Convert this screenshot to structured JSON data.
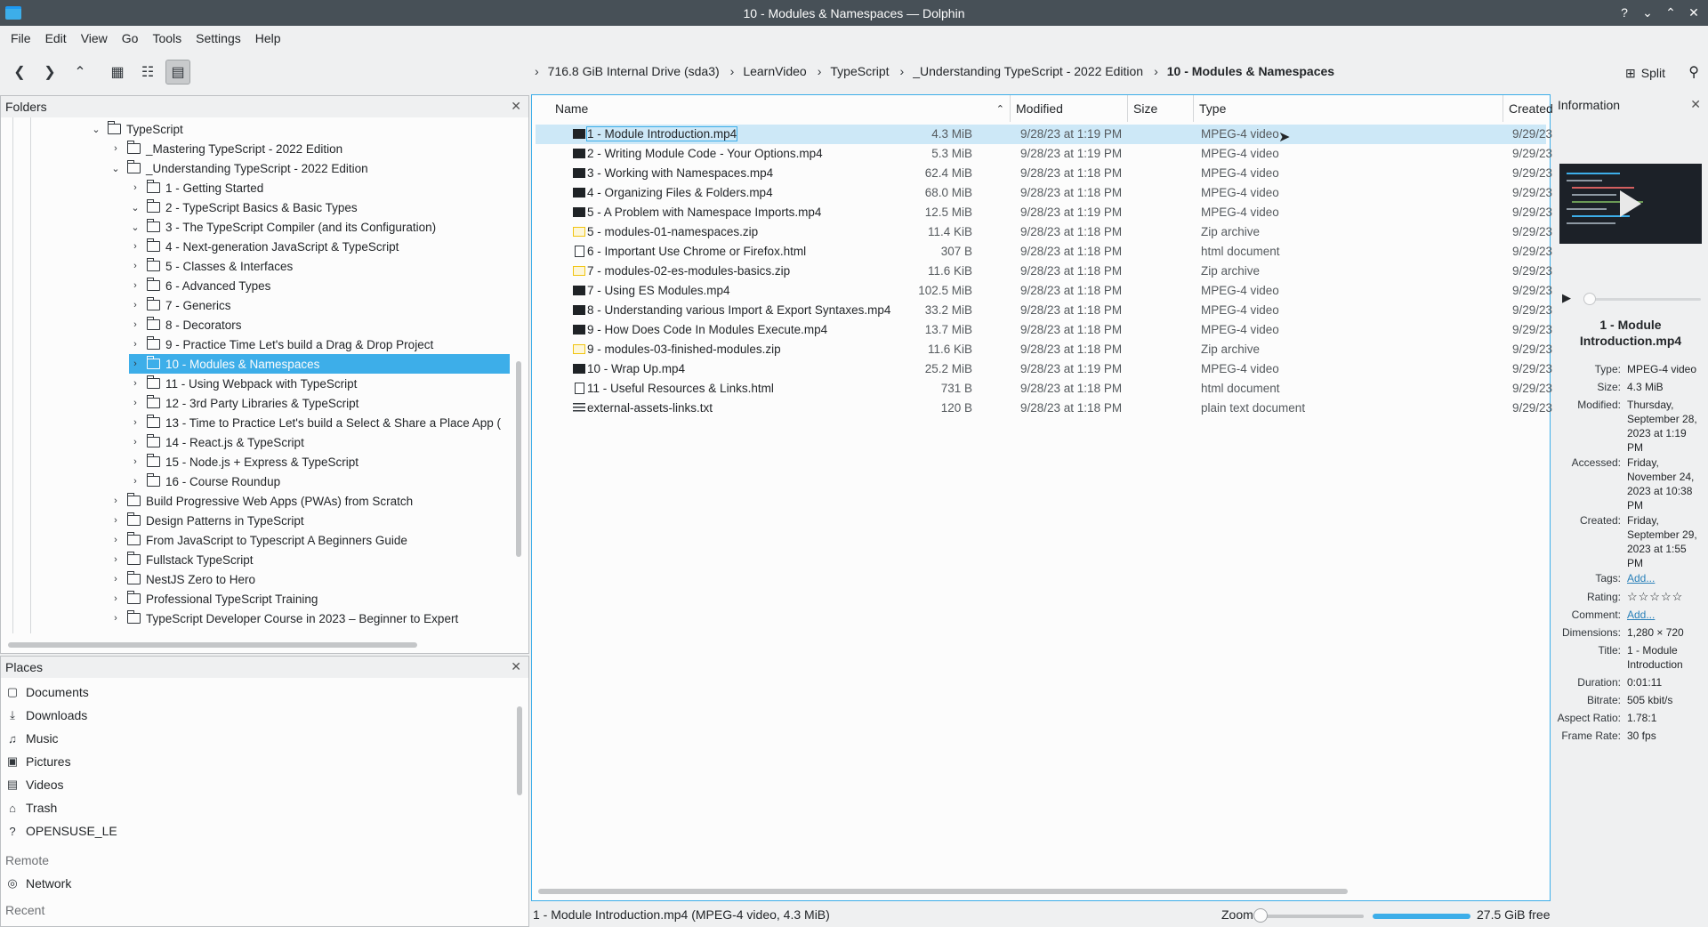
{
  "window": {
    "title": "10 - Modules & Namespaces — Dolphin"
  },
  "menu": [
    "File",
    "Edit",
    "View",
    "Go",
    "Tools",
    "Settings",
    "Help"
  ],
  "toolbar": {
    "breadcrumbs": [
      "716.8 GiB Internal Drive (sda3)",
      "LearnVideo",
      "TypeScript",
      "_Understanding TypeScript - 2022 Edition",
      "10 - Modules & Namespaces"
    ],
    "split_label": "Split"
  },
  "folders_panel": {
    "title": "Folders",
    "items": [
      {
        "label": "TypeScript",
        "depth": 0,
        "expanded": true
      },
      {
        "label": "_Mastering TypeScript - 2022 Edition",
        "depth": 1,
        "expanded": false
      },
      {
        "label": "_Understanding TypeScript - 2022 Edition",
        "depth": 1,
        "expanded": true
      },
      {
        "label": "1 - Getting Started",
        "depth": 2,
        "expanded": false
      },
      {
        "label": "2 - TypeScript Basics & Basic Types",
        "depth": 2,
        "expanded": true
      },
      {
        "label": "3 - The TypeScript Compiler (and its Configuration)",
        "depth": 2,
        "expanded": true
      },
      {
        "label": "4 - Next-generation JavaScript & TypeScript",
        "depth": 2,
        "expanded": false
      },
      {
        "label": "5 - Classes & Interfaces",
        "depth": 2,
        "expanded": false
      },
      {
        "label": "6 - Advanced Types",
        "depth": 2,
        "expanded": false
      },
      {
        "label": "7 - Generics",
        "depth": 2,
        "expanded": false
      },
      {
        "label": "8 - Decorators",
        "depth": 2,
        "expanded": false
      },
      {
        "label": "9 - Practice Time Let's build a Drag & Drop Project",
        "depth": 2,
        "expanded": false
      },
      {
        "label": "10 - Modules & Namespaces",
        "depth": 2,
        "expanded": false,
        "selected": true
      },
      {
        "label": "11 - Using Webpack with TypeScript",
        "depth": 2,
        "expanded": false
      },
      {
        "label": "12 - 3rd Party Libraries & TypeScript",
        "depth": 2,
        "expanded": false
      },
      {
        "label": "13 - Time to Practice Let's build a Select & Share a Place App (",
        "depth": 2,
        "expanded": false
      },
      {
        "label": "14 - React.js & TypeScript",
        "depth": 2,
        "expanded": false
      },
      {
        "label": "15 - Node.js + Express & TypeScript",
        "depth": 2,
        "expanded": false
      },
      {
        "label": "16 - Course Roundup",
        "depth": 2,
        "expanded": false
      },
      {
        "label": "Build Progressive Web Apps (PWAs) from Scratch",
        "depth": 1,
        "expanded": false
      },
      {
        "label": "Design Patterns in TypeScript",
        "depth": 1,
        "expanded": false
      },
      {
        "label": "From JavaScript to Typescript A Beginners Guide",
        "depth": 1,
        "expanded": false
      },
      {
        "label": "Fullstack TypeScript",
        "depth": 1,
        "expanded": false
      },
      {
        "label": "NestJS Zero to Hero",
        "depth": 1,
        "expanded": false
      },
      {
        "label": "Professional TypeScript Training",
        "depth": 1,
        "expanded": false
      },
      {
        "label": "TypeScript Developer Course in 2023 – Beginner to Expert",
        "depth": 1,
        "expanded": false
      }
    ]
  },
  "places_panel": {
    "title": "Places",
    "items": [
      {
        "label": "Documents",
        "icon": "documents-icon",
        "glyph": "▢"
      },
      {
        "label": "Downloads",
        "icon": "downloads-icon",
        "glyph": "⤓"
      },
      {
        "label": "Music",
        "icon": "music-icon",
        "glyph": "♫"
      },
      {
        "label": "Pictures",
        "icon": "pictures-icon",
        "glyph": "▣"
      },
      {
        "label": "Videos",
        "icon": "videos-icon",
        "glyph": "▤"
      },
      {
        "label": "Trash",
        "icon": "trash-icon",
        "glyph": "⌂"
      },
      {
        "label": "OPENSUSE_LE",
        "icon": "drive-icon",
        "glyph": "?"
      }
    ],
    "remote_label": "Remote",
    "network_label": "Network",
    "recent_label": "Recent"
  },
  "file_view": {
    "columns": {
      "name": "Name",
      "modified": "Modified",
      "size": "Size",
      "type": "Type",
      "created": "Created"
    },
    "files": [
      {
        "name": "1 - Module Introduction.mp4",
        "modified": "9/28/23 at 1:19 PM",
        "size": "4.3 MiB",
        "type": "MPEG-4 video",
        "created": "9/29/23",
        "kind": "video",
        "selected": true
      },
      {
        "name": "2 - Writing Module Code - Your Options.mp4",
        "modified": "9/28/23 at 1:19 PM",
        "size": "5.3 MiB",
        "type": "MPEG-4 video",
        "created": "9/29/23",
        "kind": "video"
      },
      {
        "name": "3 - Working with Namespaces.mp4",
        "modified": "9/28/23 at 1:18 PM",
        "size": "62.4 MiB",
        "type": "MPEG-4 video",
        "created": "9/29/23",
        "kind": "video"
      },
      {
        "name": "4 - Organizing Files & Folders.mp4",
        "modified": "9/28/23 at 1:18 PM",
        "size": "68.0 MiB",
        "type": "MPEG-4 video",
        "created": "9/29/23",
        "kind": "video"
      },
      {
        "name": "5 - A Problem with Namespace Imports.mp4",
        "modified": "9/28/23 at 1:19 PM",
        "size": "12.5 MiB",
        "type": "MPEG-4 video",
        "created": "9/29/23",
        "kind": "video"
      },
      {
        "name": "5 - modules-01-namespaces.zip",
        "modified": "9/28/23 at 1:18 PM",
        "size": "11.4 KiB",
        "type": "Zip archive",
        "created": "9/29/23",
        "kind": "zip"
      },
      {
        "name": "6 - Important Use Chrome or Firefox.html",
        "modified": "9/28/23 at 1:18 PM",
        "size": "307 B",
        "type": "html document",
        "created": "9/29/23",
        "kind": "doc"
      },
      {
        "name": "7 - modules-02-es-modules-basics.zip",
        "modified": "9/28/23 at 1:18 PM",
        "size": "11.6 KiB",
        "type": "Zip archive",
        "created": "9/29/23",
        "kind": "zip"
      },
      {
        "name": "7 - Using ES Modules.mp4",
        "modified": "9/28/23 at 1:18 PM",
        "size": "102.5 MiB",
        "type": "MPEG-4 video",
        "created": "9/29/23",
        "kind": "video"
      },
      {
        "name": "8 - Understanding various Import & Export Syntaxes.mp4",
        "modified": "9/28/23 at 1:18 PM",
        "size": "33.2 MiB",
        "type": "MPEG-4 video",
        "created": "9/29/23",
        "kind": "video"
      },
      {
        "name": "9 - How Does Code In Modules Execute.mp4",
        "modified": "9/28/23 at 1:18 PM",
        "size": "13.7 MiB",
        "type": "MPEG-4 video",
        "created": "9/29/23",
        "kind": "video"
      },
      {
        "name": "9 - modules-03-finished-modules.zip",
        "modified": "9/28/23 at 1:18 PM",
        "size": "11.6 KiB",
        "type": "Zip archive",
        "created": "9/29/23",
        "kind": "zip"
      },
      {
        "name": "10 - Wrap Up.mp4",
        "modified": "9/28/23 at 1:19 PM",
        "size": "25.2 MiB",
        "type": "MPEG-4 video",
        "created": "9/29/23",
        "kind": "video"
      },
      {
        "name": "11 - Useful Resources & Links.html",
        "modified": "9/28/23 at 1:18 PM",
        "size": "731 B",
        "type": "html document",
        "created": "9/29/23",
        "kind": "doc"
      },
      {
        "name": "external-assets-links.txt",
        "modified": "9/28/23 at 1:18 PM",
        "size": "120 B",
        "type": "plain text document",
        "created": "9/29/23",
        "kind": "txt"
      }
    ]
  },
  "info_panel": {
    "title": "Information",
    "file_name": "1 - Module Introduction.mp4",
    "fields": [
      {
        "key": "Type:",
        "value": "MPEG-4 video"
      },
      {
        "key": "Size:",
        "value": "4.3 MiB"
      },
      {
        "key": "Modified:",
        "value": "Thursday, September 28, 2023 at 1:19 PM"
      },
      {
        "key": "Accessed:",
        "value": "Friday, November 24, 2023 at 10:38 PM"
      },
      {
        "key": "Created:",
        "value": "Friday, September 29, 2023 at 1:55 PM"
      },
      {
        "key": "Tags:",
        "value": "Add...",
        "link": true
      },
      {
        "key": "Rating:",
        "value": "☆☆☆☆☆",
        "stars": true
      },
      {
        "key": "Comment:",
        "value": "Add...",
        "link": true
      },
      {
        "key": "Dimensions:",
        "value": "1,280 × 720"
      },
      {
        "key": "Title:",
        "value": "1 - Module Introduction"
      },
      {
        "key": "Duration:",
        "value": "0:01:11"
      },
      {
        "key": "Bitrate:",
        "value": "505 kbit/s"
      },
      {
        "key": "Aspect Ratio:",
        "value": "1.78:1"
      },
      {
        "key": "Frame Rate:",
        "value": "30 fps"
      }
    ]
  },
  "status_bar": {
    "text": "1 - Module Introduction.mp4 (MPEG-4 video, 4.3 MiB)",
    "zoom_label": "Zoom:",
    "free_space": "27.5 GiB free"
  },
  "colors": {
    "accent": "#3daee9",
    "selection": "#cde8f7",
    "titlebar": "#475057"
  }
}
